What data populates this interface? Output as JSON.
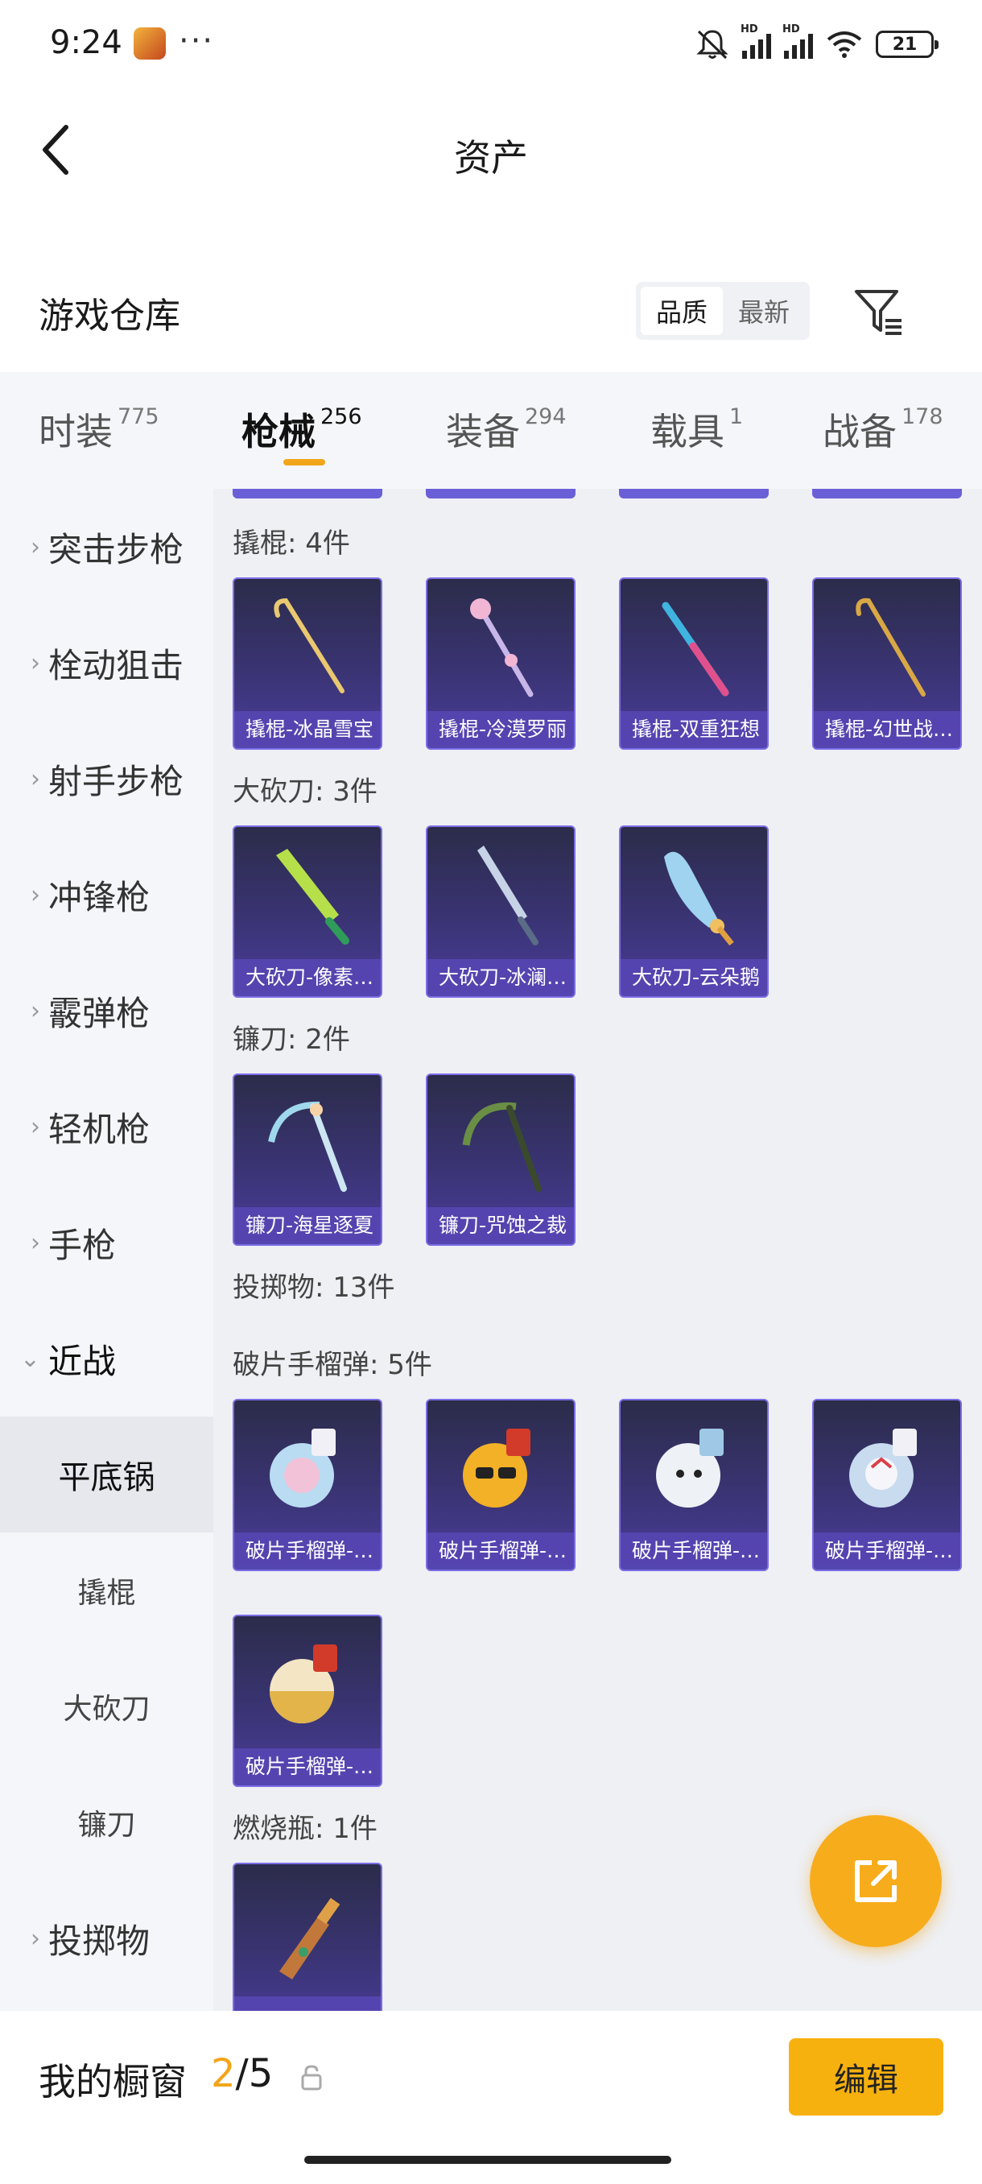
{
  "status_bar": {
    "time": "9:24",
    "more": "···",
    "hd_label": "HD",
    "battery": "21"
  },
  "header": {
    "title": "资产"
  },
  "warehouse": {
    "title": "游戏仓库",
    "sort_options": [
      "品质",
      "最新"
    ],
    "active_sort": "品质"
  },
  "tabs": [
    {
      "label": "时装",
      "count": "775"
    },
    {
      "label": "枪械",
      "count": "256"
    },
    {
      "label": "装备",
      "count": "294"
    },
    {
      "label": "载具",
      "count": "1"
    },
    {
      "label": "战备",
      "count": "178"
    }
  ],
  "active_tab": "枪械",
  "sidebar": {
    "items": [
      {
        "label": "突击步枪"
      },
      {
        "label": "栓动狙击"
      },
      {
        "label": "射手步枪"
      },
      {
        "label": "冲锋枪"
      },
      {
        "label": "霰弹枪"
      },
      {
        "label": "轻机枪"
      },
      {
        "label": "手枪"
      },
      {
        "label": "近战"
      }
    ],
    "sub_items": [
      {
        "label": "平底锅"
      },
      {
        "label": "撬棍"
      },
      {
        "label": "大砍刀"
      },
      {
        "label": "镰刀"
      }
    ],
    "after": {
      "label": "投掷物"
    }
  },
  "content": {
    "groups": [
      {
        "title": "撬棍: 4件",
        "items": [
          "撬棍-冰晶雪宝",
          "撬棍-冷漠罗丽",
          "撬棍-双重狂想",
          "撬棍-幻世战…"
        ]
      },
      {
        "title": "大砍刀: 3件",
        "items": [
          "大砍刀-像素…",
          "大砍刀-冰澜…",
          "大砍刀-云朵鹅"
        ]
      },
      {
        "title": "镰刀: 2件",
        "items": [
          "镰刀-海星逐夏",
          "镰刀-咒蚀之裁"
        ]
      },
      {
        "title": "投掷物: 13件",
        "items": []
      },
      {
        "title": "破片手榴弹: 5件",
        "items": [
          "破片手榴弹-…",
          "破片手榴弹-…",
          "破片手榴弹-…",
          "破片手榴弹-…",
          "破片手榴弹-…"
        ]
      },
      {
        "title": "燃烧瓶: 1件",
        "items": [
          ""
        ]
      }
    ]
  },
  "bottom_bar": {
    "label": "我的橱窗",
    "current": "2",
    "separator": "/",
    "total": "5",
    "edit_label": "编辑"
  },
  "colors": {
    "accent": "#f7b10f",
    "card_border": "#7b6de6",
    "card_bg": "#3a3474"
  },
  "icons": [
    "back-icon",
    "filter-icon",
    "chevron-right-icon",
    "chevron-down-icon",
    "share-icon",
    "lock-icon",
    "wifi-icon",
    "mute-icon",
    "battery-icon"
  ]
}
